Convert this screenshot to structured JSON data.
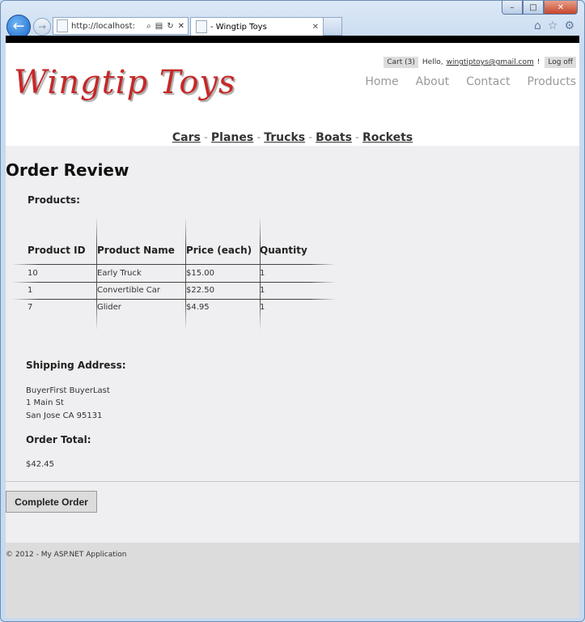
{
  "browser": {
    "url": "http://localhost:",
    "tab_title": "Wingtip Toys"
  },
  "site": {
    "logo": "Wingtip Toys",
    "cart": "Cart (3)",
    "hello": "Hello,",
    "email": "wingtiptoys@gmail.com",
    "excl": "!",
    "logoff": "Log off",
    "nav": [
      "Home",
      "About",
      "Contact",
      "Products"
    ],
    "categories": [
      "Cars",
      "Planes",
      "Trucks",
      "Boats",
      "Rockets"
    ]
  },
  "order": {
    "title": "Order Review",
    "products_label": "Products:",
    "columns": [
      "Product ID",
      "Product Name",
      "Price (each)",
      "Quantity"
    ],
    "rows": [
      [
        "10",
        "Early Truck",
        "$15.00",
        "1"
      ],
      [
        "1",
        "Convertible Car",
        "$22.50",
        "1"
      ],
      [
        "7",
        "Glider",
        "$4.95",
        "1"
      ]
    ],
    "shipping_label": "Shipping Address:",
    "address": [
      "BuyerFirst BuyerLast",
      "1 Main St",
      "San Jose CA 95131"
    ],
    "total_label": "Order Total:",
    "total": "$42.45",
    "complete_button": "Complete Order"
  },
  "footer": "© 2012 - My ASP.NET Application"
}
